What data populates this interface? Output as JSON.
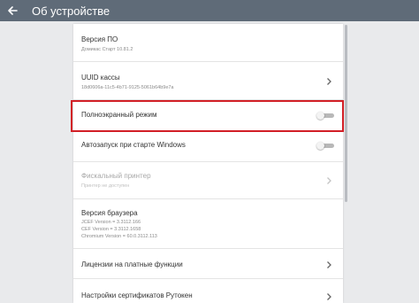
{
  "header": {
    "title": "Об устройстве",
    "back_icon": "arrow-left-icon"
  },
  "colors": {
    "header_bg": "#5f6b78",
    "highlight": "#d21f26"
  },
  "settings": {
    "firmware": {
      "title": "Версия ПО",
      "sub": "Домикас Старт 10.81.2"
    },
    "uuid": {
      "title": "UUID кассы",
      "sub": "18d0606a-11c5-4b71-9125-5061b64b9e7a"
    },
    "fullscreen": {
      "title": "Полноэкранный режим",
      "toggle_on": false
    },
    "autostart": {
      "title": "Автозапуск при старте Windows",
      "toggle_on": false
    },
    "fiscal_printer": {
      "title": "Фискальный принтер",
      "sub": "Принтер не доступен"
    },
    "browser": {
      "title": "Версия браузера",
      "lines": [
        "JCEF Version = 3.3112.166",
        "CEF Version = 3.3112.1658",
        "Chromium Version = 60.0.3112.113"
      ]
    },
    "licenses": {
      "title": "Лицензии на платные функции"
    },
    "rutoken": {
      "title": "Настройки сертификатов Рутокен"
    }
  }
}
